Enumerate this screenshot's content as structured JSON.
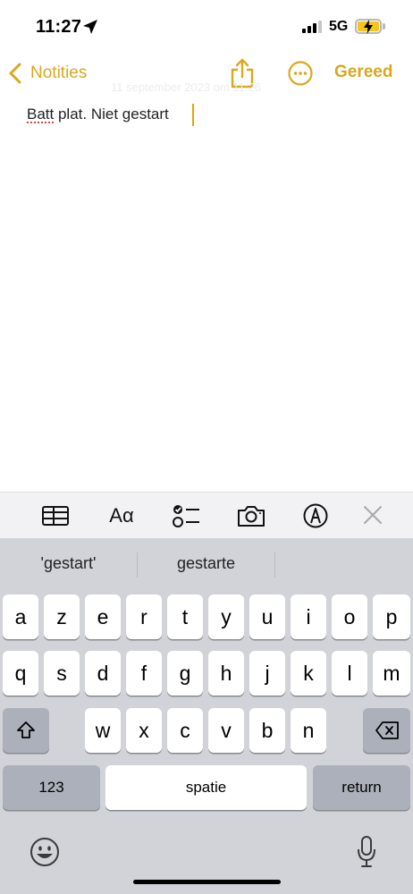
{
  "status_bar": {
    "time": "11:27",
    "network": "5G"
  },
  "nav": {
    "back_label": "Notities",
    "done_label": "Gereed",
    "ghost_text": "11 september 2023 om 11:26"
  },
  "note": {
    "word1": "Batt",
    "rest": " plat. Niet gestart"
  },
  "toolbar": {
    "format_label": "Aα"
  },
  "keyboard": {
    "suggestions": [
      "'gestart'",
      "gestarte",
      ""
    ],
    "row1": [
      "a",
      "z",
      "e",
      "r",
      "t",
      "y",
      "u",
      "i",
      "o",
      "p"
    ],
    "row2": [
      "q",
      "s",
      "d",
      "f",
      "g",
      "h",
      "j",
      "k",
      "l",
      "m"
    ],
    "row3": [
      "w",
      "x",
      "c",
      "v",
      "b",
      "n"
    ],
    "numbers_label": "123",
    "space_label": "spatie",
    "return_label": "return"
  },
  "colors": {
    "accent": "#d9a81f",
    "keyboard_bg": "#d1d3d9",
    "toolbar_bg": "#f2f2f5"
  }
}
